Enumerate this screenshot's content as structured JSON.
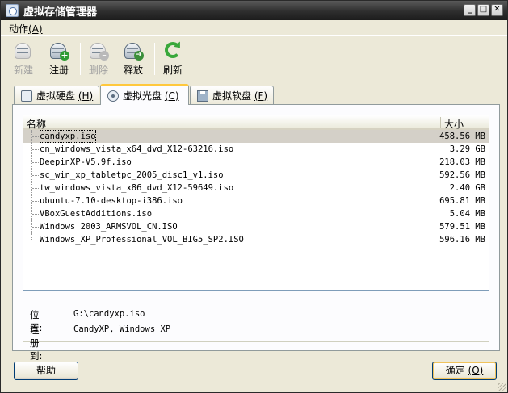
{
  "window": {
    "title": "虚拟存储管理器",
    "buttons": [
      "_",
      "□",
      "✕"
    ]
  },
  "menu": [
    {
      "label": "动作",
      "mnemonic": "(A)"
    }
  ],
  "toolbar": [
    {
      "label": "新建",
      "enabled": false,
      "icon": "new-disk-icon"
    },
    {
      "label": "注册",
      "enabled": true,
      "icon": "register-disk-icon"
    },
    {
      "label": "删除",
      "enabled": false,
      "icon": "remove-disk-icon"
    },
    {
      "label": "释放",
      "enabled": true,
      "icon": "release-disk-icon"
    },
    {
      "label": "刷新",
      "enabled": true,
      "icon": "refresh-icon"
    }
  ],
  "tabs": [
    {
      "label": "虚拟硬盘",
      "mnemonic": "(H)",
      "active": false,
      "icon": "hard-disk-icon"
    },
    {
      "label": "虚拟光盘",
      "mnemonic": "(C)",
      "active": true,
      "icon": "cd-icon"
    },
    {
      "label": "虚拟软盘",
      "mnemonic": "(F)",
      "active": false,
      "icon": "floppy-icon"
    }
  ],
  "list": {
    "columns": {
      "name": "名称",
      "size": "大小"
    },
    "rows": [
      {
        "name": "candyxp.iso",
        "size": "458.56 MB",
        "selected": true
      },
      {
        "name": "cn_windows_vista_x64_dvd_X12-63216.iso",
        "size": "3.29 GB"
      },
      {
        "name": "DeepinXP-V5.9f.iso",
        "size": "218.03 MB"
      },
      {
        "name": "sc_win_xp_tabletpc_2005_disc1_v1.iso",
        "size": "592.56 MB"
      },
      {
        "name": "tw_windows_vista_x86_dvd_X12-59649.iso",
        "size": "2.40 GB"
      },
      {
        "name": "ubuntu-7.10-desktop-i386.iso",
        "size": "695.81 MB"
      },
      {
        "name": "VBoxGuestAdditions.iso",
        "size": "5.04 MB"
      },
      {
        "name": "Windows 2003_ARMSVOL_CN.ISO",
        "size": "579.51 MB"
      },
      {
        "name": "Windows_XP_Professional_VOL_BIG5_SP2.ISO",
        "size": "596.16 MB"
      }
    ]
  },
  "info": {
    "location_label": "位置:",
    "location_value": "G:\\candyxp.iso",
    "registered_label": "注册到:",
    "registered_value": "CandyXP, Windows XP"
  },
  "buttons": {
    "help": "帮助",
    "ok": "确定",
    "ok_mnemonic": "(O)"
  }
}
